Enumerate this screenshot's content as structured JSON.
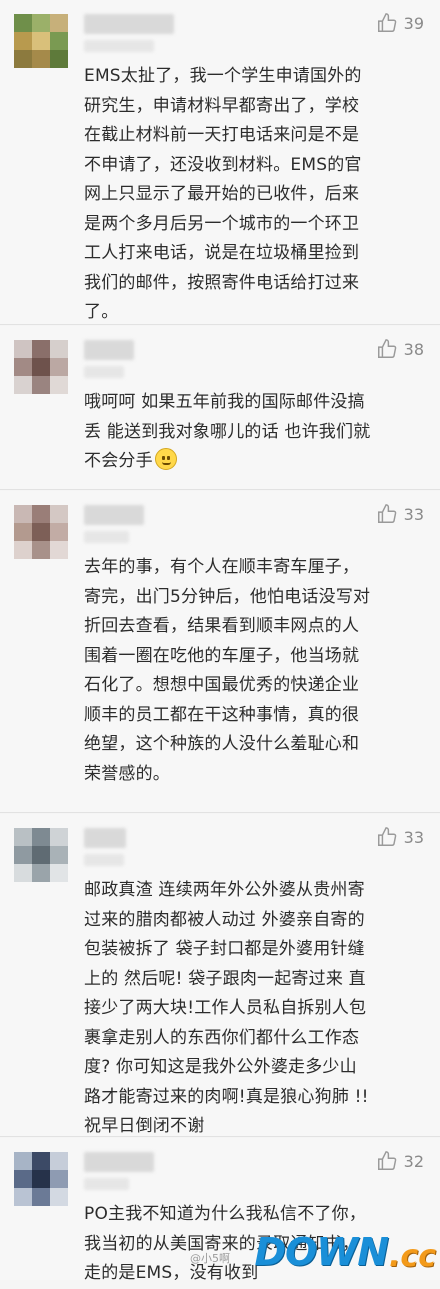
{
  "comments": [
    {
      "likes": "39",
      "lines": [
        "EMS太扯了，我一个学生申请国外的",
        "研究生，申请材料早都寄出了，学校",
        "在截止材料前一天打电话来问是不是",
        "不申请了，还没收到材料。EMS的官",
        "网上只显示了最开始的已收件，后来",
        "是两个多月后另一个城市的一个环卫",
        "工人打来电话，说是在垃圾桶里捡到",
        "我们的邮件，按照寄件电话给打过来",
        "了。"
      ]
    },
    {
      "likes": "38",
      "lines": [
        "哦呵呵  如果五年前我的国际邮件没搞",
        "丢 能送到我对象哪儿的话 也许我们就",
        "不会分手"
      ]
    },
    {
      "likes": "33",
      "lines": [
        "去年的事，有个人在顺丰寄车厘子，",
        "寄完，出门5分钟后，他怕电话没写对",
        "折回去查看，结果看到顺丰网点的人",
        "围着一圈在吃他的车厘子，他当场就",
        "石化了。想想中国最优秀的快递企业",
        "顺丰的员工都在干这种事情，真的很",
        "绝望，这个种族的人没什么羞耻心和",
        "荣誉感的。"
      ]
    },
    {
      "likes": "33",
      "lines": [
        "邮政真渣 连续两年外公外婆从贵州寄",
        "过来的腊肉都被人动过 外婆亲自寄的",
        "包装被拆了 袋子封口都是外婆用针缝",
        "上的 然后呢! 袋子跟肉一起寄过来 直",
        "接少了两大块!工作人员私自拆别人包",
        "裹拿走别人的东西你们都什么工作态",
        "度? 你可知这是我外公外婆走多少山",
        "路才能寄过来的肉啊!真是狼心狗肺 !!",
        "祝早日倒闭不谢"
      ]
    },
    {
      "likes": "32",
      "lines": [
        "PO主我不知道为什么我私信不了你，",
        "我当初的从美国寄来的录取通知书，",
        "走的是EMS，没有收到"
      ]
    }
  ],
  "watermark": {
    "brand_main": "DOWN",
    "brand_suffix": ".cc",
    "credit": "@小5啊"
  },
  "colors": {
    "accent_blue": "#1a8fd8",
    "accent_orange": "#f39a1a",
    "like_gray": "#8a8a8a"
  }
}
